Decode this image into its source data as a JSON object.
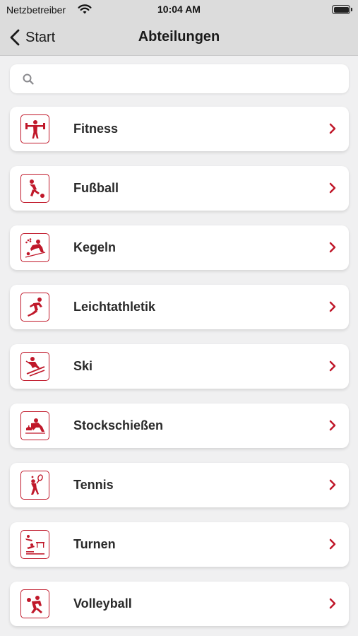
{
  "status_bar": {
    "carrier": "Netzbetreiber",
    "time": "10:04 AM"
  },
  "nav": {
    "back_label": "Start",
    "title": "Abteilungen"
  },
  "search": {
    "placeholder": "",
    "value": ""
  },
  "accent_color": "#c0182a",
  "departments": [
    {
      "label": "Fitness",
      "icon": "fitness-icon"
    },
    {
      "label": "Fußball",
      "icon": "soccer-icon"
    },
    {
      "label": "Kegeln",
      "icon": "bowling-icon"
    },
    {
      "label": "Leichtathletik",
      "icon": "running-icon"
    },
    {
      "label": "Ski",
      "icon": "ski-icon"
    },
    {
      "label": "Stockschießen",
      "icon": "curling-icon"
    },
    {
      "label": "Tennis",
      "icon": "tennis-icon"
    },
    {
      "label": "Turnen",
      "icon": "gymnastics-icon"
    },
    {
      "label": "Volleyball",
      "icon": "volleyball-icon"
    }
  ]
}
